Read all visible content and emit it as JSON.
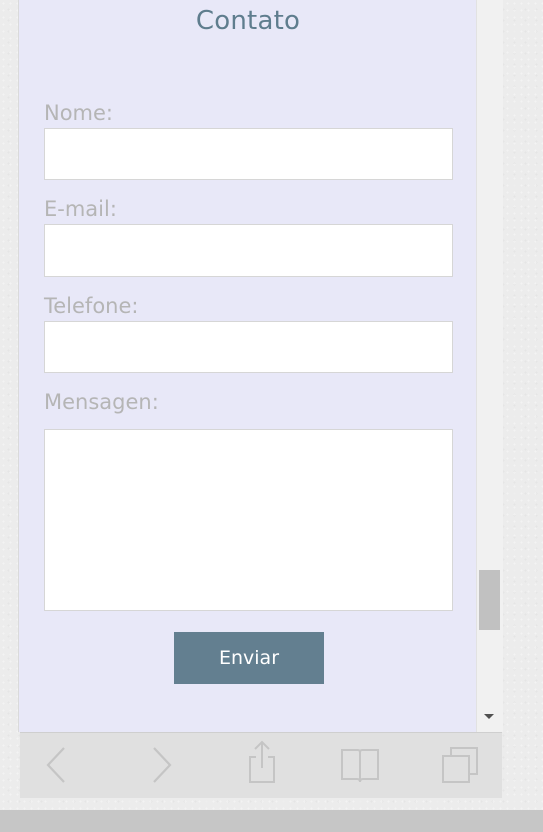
{
  "form": {
    "title": "Contato",
    "fields": [
      {
        "label": "Nome:",
        "value": "",
        "placeholder": ""
      },
      {
        "label": "E-mail:",
        "value": "",
        "placeholder": ""
      },
      {
        "label": "Telefone:",
        "value": "",
        "placeholder": ""
      },
      {
        "label": "Mensagen:",
        "value": "",
        "placeholder": ""
      }
    ],
    "submit_label": "Enviar"
  },
  "toolbar": {
    "icons": [
      "back-icon",
      "forward-icon",
      "share-icon",
      "bookmarks-icon",
      "tabs-icon"
    ]
  },
  "colors": {
    "page_bg": "#e8e8f8",
    "title": "#5f7d8e",
    "label": "#b5b5b5",
    "button": "#637f90"
  }
}
